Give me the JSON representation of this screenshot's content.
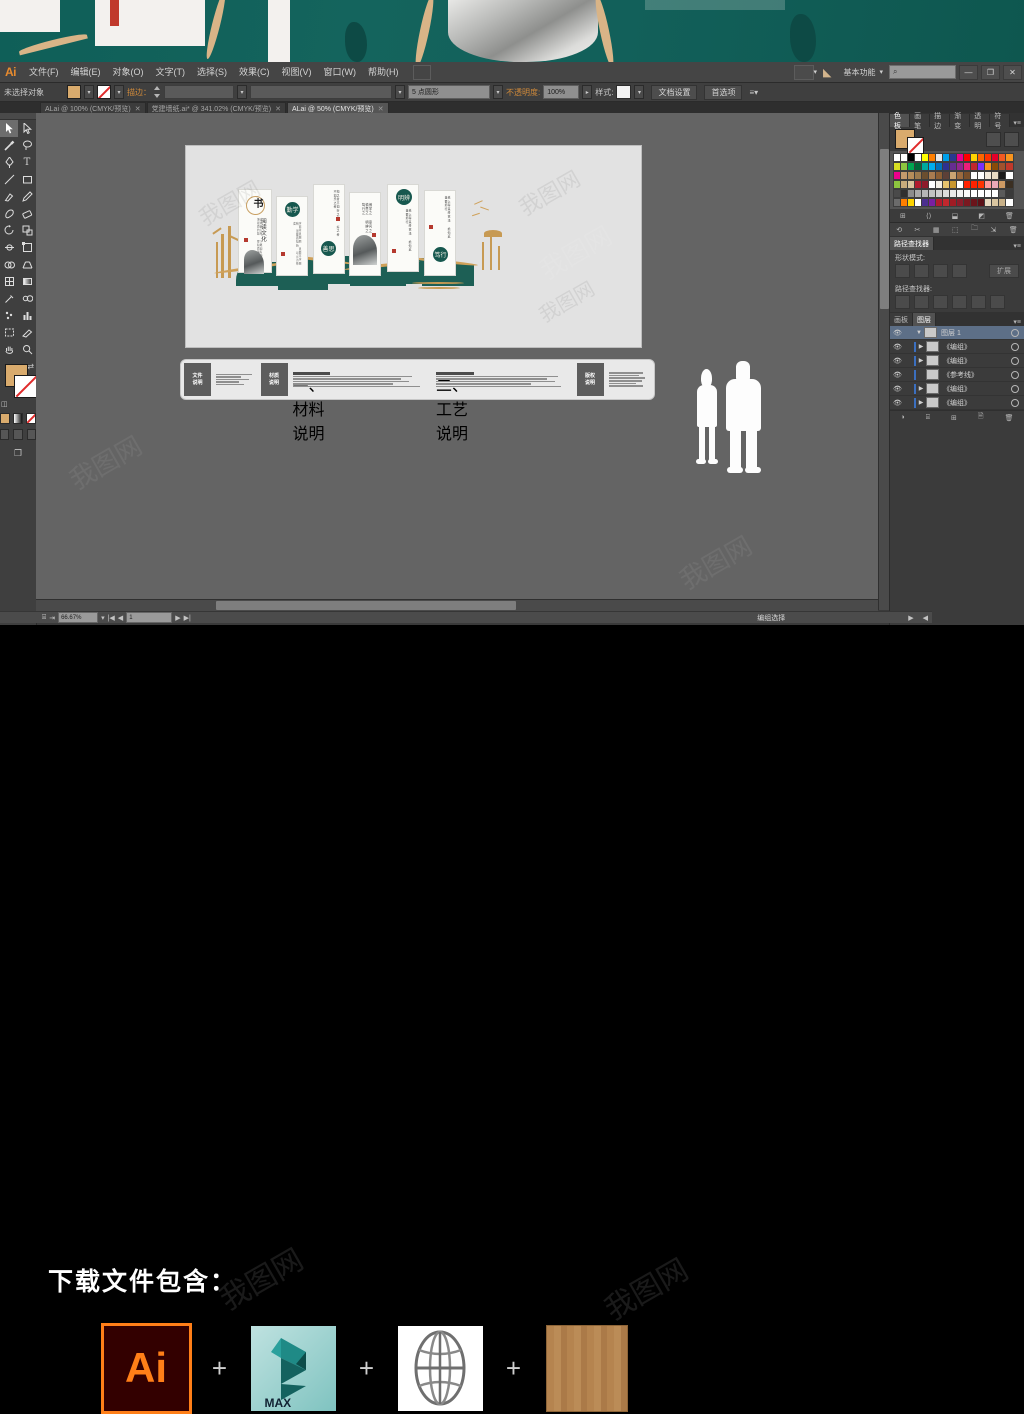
{
  "app": {
    "name": "Ai",
    "menus": [
      "文件(F)",
      "编辑(E)",
      "对象(O)",
      "文字(T)",
      "选择(S)",
      "效果(C)",
      "视图(V)",
      "窗口(W)",
      "帮助(H)"
    ],
    "workspace": "基本功能",
    "workspace_caret": "▾",
    "search_icon": "⌕",
    "window_buttons": [
      "—",
      "❐",
      "✕"
    ]
  },
  "control_bar": {
    "selection_status": "未选择对象",
    "stroke_label": "描边：",
    "stroke_weight": "5 点圆形",
    "opacity_label": "不透明度:",
    "opacity_value": "100%",
    "style_label": "样式:",
    "doc_setup": "文档设置",
    "preferences": "首选项",
    "overflow": "≡▾"
  },
  "tabs": [
    {
      "label": "ALai @ 100% (CMYK/预览)",
      "close": "✕",
      "active": false
    },
    {
      "label": "党建墙纸.ai* @ 341.02% (CMYK/预览)",
      "close": "✕",
      "active": false
    },
    {
      "label": "ALai @ 50% (CMYK/预览)",
      "close": "✕",
      "active": true
    }
  ],
  "toolbar": {
    "tools": [
      "selection-tool",
      "direct-selection-tool",
      "magic-wand-tool",
      "lasso-tool",
      "pen-tool",
      "type-tool",
      "line-tool",
      "rectangle-tool",
      "paintbrush-tool",
      "pencil-tool",
      "blob-brush-tool",
      "eraser-tool",
      "rotate-tool",
      "scale-tool",
      "width-tool",
      "free-transform-tool",
      "shape-builder-tool",
      "perspective-grid-tool",
      "mesh-tool",
      "gradient-tool",
      "eyedropper-tool",
      "blend-tool",
      "symbol-sprayer-tool",
      "column-graph-tool",
      "artboard-tool",
      "slice-tool",
      "hand-tool",
      "zoom-tool"
    ],
    "fill_color": "#d9ab6d",
    "stroke_color": "#ffffff",
    "swap_icon": "⇄",
    "default_icon": "◫"
  },
  "artwork": {
    "title": "书",
    "subtitle": "阅读文化",
    "panel_headings": [
      "书",
      "勤学",
      "善思",
      "明辨",
      "笃行"
    ],
    "panel_texts": [
      "阅读文化",
      "读书破万卷 下笔如有神 博观而约取 厚积而薄发",
      "学而不思则罔 思而不学则殆 温故而知新 可以为师矣",
      "知之者不如好之者 好之者不如乐之者",
      "博学之 审问之 慎思之 明辨之 笃行之",
      "纸上得来终觉浅 绝知此事要躬行"
    ],
    "wall_green": "#1d5f55",
    "wall_gold": "#cfa15a",
    "seal_color": "#b5392f"
  },
  "info_strip": {
    "sections": [
      {
        "tag": "文件\n说明",
        "tag_line1": "文件",
        "tag_line2": "说明"
      },
      {
        "tag": "材质\n说明",
        "tag_line1": "材质",
        "tag_line2": "说明"
      },
      {
        "tag": "版权\n说明",
        "tag_line1": "版权",
        "tag_line2": "说明"
      }
    ],
    "headers": [
      "一、材料说明",
      "二、工艺说明"
    ]
  },
  "status_bar_top": {
    "zoom": "50%",
    "page": "1",
    "tool": "编组选择",
    "prev_icon": "◀",
    "next_icon": "▶"
  },
  "status_bar_bottom": {
    "zoom": "66.67%",
    "page": "1",
    "tool": "编组选择"
  },
  "dock": {
    "swatch_tabs": [
      "色板",
      "画笔",
      "描边",
      "渐变",
      "透明",
      "符号"
    ],
    "swatch_active": "色板",
    "swatch_menu": "▾≡",
    "swatch_footer_icons": [
      "⊞",
      "⟨⟩",
      "⬓",
      "◩",
      "🗑"
    ],
    "pathfinder_title": "路径查找器",
    "pathfinder_shape_label": "形状模式:",
    "pathfinder_path_label": "路径查找器:",
    "expand_button": "扩展",
    "toolbar_row_icons": [
      "⟲",
      "✂",
      "▦",
      "⬚",
      "🗀",
      "⇲",
      "🗑"
    ],
    "layers_tabs": [
      "画板",
      "图层"
    ],
    "layers_active": "图层",
    "layers": [
      {
        "name": "图层 1",
        "selected": true,
        "has_children": true
      },
      {
        "name": "《编组》",
        "selected": false,
        "has_children": true
      },
      {
        "name": "《编组》",
        "selected": false,
        "has_children": true
      },
      {
        "name": "《参考线》",
        "selected": false,
        "has_children": false
      },
      {
        "name": "《编组》",
        "selected": false,
        "has_children": true
      },
      {
        "name": "《编组》",
        "selected": false,
        "has_children": true
      }
    ],
    "eye_icon": "👁",
    "expand_icon": "▶",
    "collapse_icon": "▼",
    "target_icon": "○"
  },
  "swatch_colors": [
    [
      "#ffffff",
      "#ffffff",
      "#000000",
      "#ffffff",
      "#ffff00",
      "#ff7f00",
      "#e8e8e8",
      "#00a0e9",
      "#2b3990",
      "#ec008c",
      "#ff0000",
      "#ffd400",
      "#ff6600",
      "#ff3300",
      "#e4002b",
      "#f15a22",
      "#f7941e"
    ],
    [
      "#d7df23",
      "#8dc63f",
      "#00a651",
      "#006838",
      "#00a99d",
      "#00aeef",
      "#0072bc",
      "#2e3192",
      "#662d91",
      "#92278f",
      "#ed1e79",
      "#c1272d",
      "#7b2ff7",
      "#f7941e",
      "#8a4b08",
      "#a0522d",
      "#c0392b"
    ],
    [
      "#ec008c",
      "#c49a6c",
      "#b68d5a",
      "#9c7a4e",
      "#6b4e2e",
      "#a97c50",
      "#8b5e34",
      "#5d4037",
      "#caa472",
      "#9c6b3f",
      "#7a4f2a",
      "#ffffff",
      "#ffffff",
      "#f1e8d9",
      "#e8dcc6",
      "#1a1a1a",
      "#ffffff"
    ],
    [
      "#8dc63f",
      "#c8ab7c",
      "#d8c29b",
      "#b01b2e",
      "#8c1c2b",
      "#ffffff",
      "#f3efe6",
      "#e6c36e",
      "#c8972f",
      "#ffffff",
      "#ff2200",
      "#ff2200",
      "#ff3300",
      "#ff9999",
      "#eaa9b8",
      "#cf9b63",
      "#3b2f22"
    ],
    [
      "#4a4a4a",
      "#2f2f2f",
      "#8c8c8c",
      "#a8a8a8",
      "#b5b5b5",
      "#c2c2c2",
      "#cfcfcf",
      "#dcdcdc",
      "#e9e9e9",
      "#f2f2f2",
      "#fafafa",
      "#ffffff",
      "#ffffff",
      "#ffffff",
      "#ffffff",
      "#5a5a5a",
      "#3a3a3a"
    ],
    [
      "#6b6b6b",
      "#ff7f00",
      "#ffd400",
      "#ffffff",
      "#4b2f8f",
      "#7a1fa2",
      "#b01b2e",
      "#c1272d",
      "#a01b24",
      "#8c1c2b",
      "#7a1820",
      "#6b141b",
      "#5c1117",
      "#e8d9bf",
      "#d9c5a0",
      "#c8b189",
      "#ffffff"
    ]
  ],
  "promo": {
    "title": "下载文件包含：",
    "items": [
      {
        "name": "ai-file-icon",
        "label": "Ai"
      },
      {
        "name": "3dsmax-file-icon",
        "label": "MAX"
      },
      {
        "name": "web-globe-icon",
        "label": ""
      },
      {
        "name": "wood-texture-icon",
        "label": ""
      }
    ],
    "separator": "+"
  },
  "watermark": "我图网"
}
